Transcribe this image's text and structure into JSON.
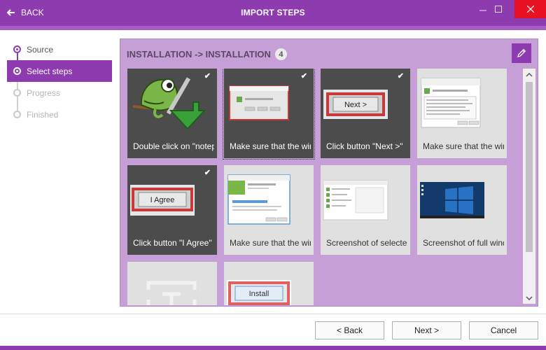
{
  "titlebar": {
    "back_label": "BACK",
    "title": "IMPORT STEPS",
    "accent": "#8e3bb0",
    "close_color": "#e81123"
  },
  "wizard_steps": [
    {
      "label": "Source",
      "state": "done"
    },
    {
      "label": "Select steps",
      "state": "active"
    },
    {
      "label": "Progress",
      "state": "pending"
    },
    {
      "label": "Finished",
      "state": "pending"
    }
  ],
  "panel": {
    "header": "INSTALLATION -> INSTALLATION",
    "count": "4",
    "edit_icon": "pencil-icon",
    "background": "#c79fd7"
  },
  "cards": [
    {
      "caption": "Double click on \"notepad++.exe\"",
      "selected": true
    },
    {
      "caption": "Make sure that the window appears",
      "selected": true
    },
    {
      "caption": "Click button \"Next >\"",
      "selected": true
    },
    {
      "caption": "Make sure that the window appears",
      "selected": false
    },
    {
      "caption": "Click button \"I Agree\"",
      "selected": true
    },
    {
      "caption": "Make sure that the window appears",
      "selected": false
    },
    {
      "caption": "Screenshot of selected area",
      "selected": false
    },
    {
      "caption": "Screenshot of full window",
      "selected": false
    },
    {
      "caption": "",
      "selected": false
    },
    {
      "caption": "",
      "selected": false
    }
  ],
  "thumb_text": {
    "next_button": "Next >",
    "agree_button": "I Agree",
    "install_button": "Install"
  },
  "footer": {
    "back_label": "< Back",
    "next_label": "Next >",
    "cancel_label": "Cancel"
  }
}
